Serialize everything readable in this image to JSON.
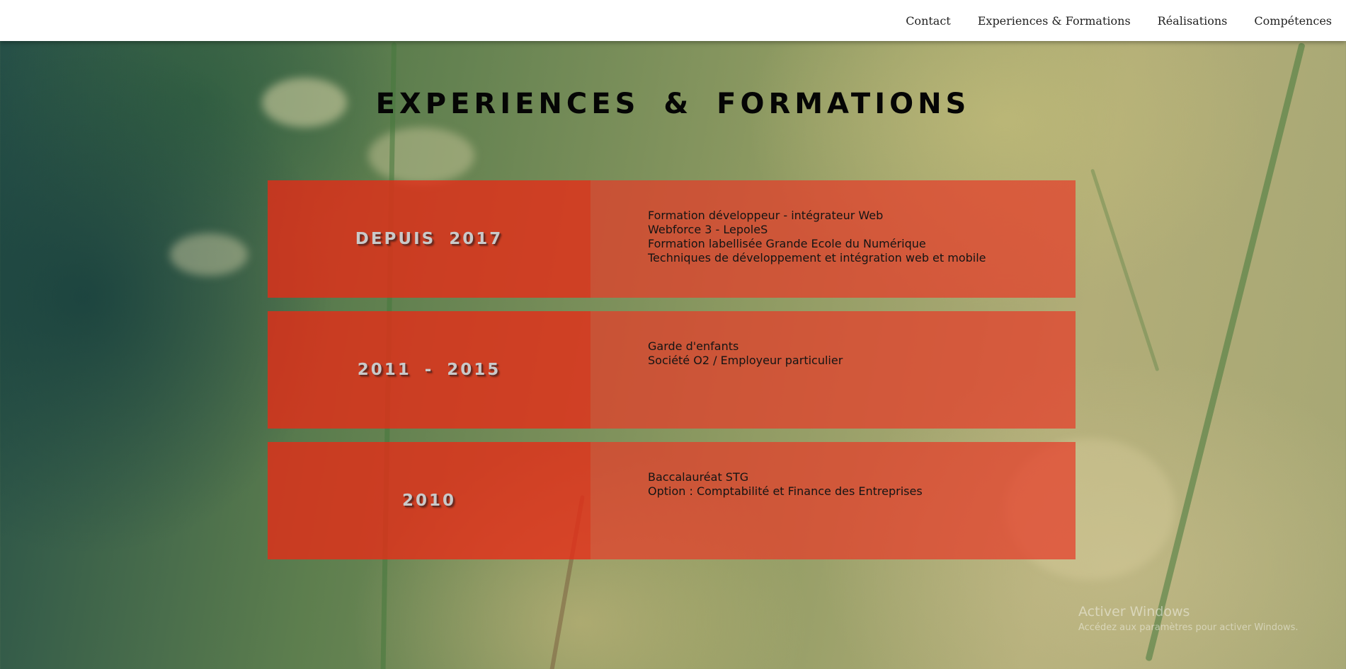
{
  "nav": {
    "links": [
      "Contact",
      "Experiences & Formations",
      "Réalisations",
      "Compétences"
    ]
  },
  "page": {
    "title": "EXPERIENCES & FORMATIONS"
  },
  "timeline": [
    {
      "date": "DEPUIS 2017",
      "details": [
        "Formation développeur - intégrateur Web",
        "Webforce 3 - LepoleS",
        "Formation labellisée Grande Ecole du Numérique",
        "Techniques de développement et intégration web et mobile"
      ]
    },
    {
      "date": "2011 - 2015",
      "details": [
        "Garde d'enfants",
        "Société O2 / Employeur particulier"
      ]
    },
    {
      "date": "2010",
      "details": [
        "Baccalauréat STG",
        "Option : Comptabilité et Finance des Entreprises"
      ]
    }
  ],
  "watermark": {
    "title": "Activer Windows",
    "subtitle": "Accédez aux paramètres pour activer Windows."
  },
  "colors": {
    "date_panel": "#e82a16",
    "details_panel": "#e63c28",
    "navbar_bg": "#ffffff"
  }
}
